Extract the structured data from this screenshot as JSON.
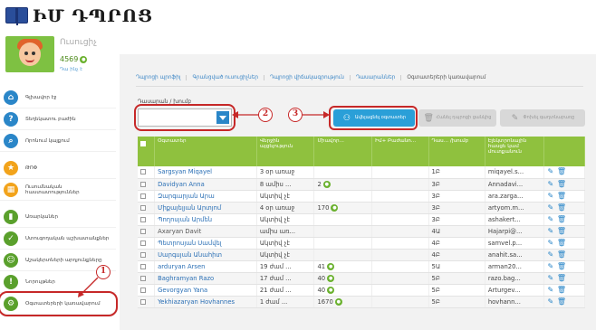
{
  "brand": {
    "title": "ԻՄ ԴՊՐՈՑ"
  },
  "profile": {
    "name": "Ուսուցիչ",
    "points": "4569",
    "what_is": "Դա ինչ է"
  },
  "sidebar": {
    "items": [
      {
        "label": "Գլխավոր էջ",
        "icon": "house-icon",
        "glyph": "⌂",
        "color": "#2a86c8"
      },
      {
        "label": "Տեղեկատու բաժին",
        "icon": "question-icon",
        "glyph": "?",
        "color": "#2a86c8"
      },
      {
        "label": "Որոնում կայքում",
        "icon": "search-icon",
        "glyph": "⌕",
        "color": "#2a86c8"
      },
      {
        "label": "ԹՈՓ",
        "icon": "star-icon",
        "glyph": "★",
        "color": "#f2a31b"
      },
      {
        "label": "Ուսումնական հաստատություններ",
        "icon": "building-icon",
        "glyph": "▦",
        "color": "#f2a31b"
      },
      {
        "label": "Առարկաներ",
        "icon": "books-icon",
        "glyph": "▮",
        "color": "#5aa02c"
      },
      {
        "label": "Ստուգողական աշխատանքներ",
        "icon": "check-icon",
        "glyph": "✓",
        "color": "#5aa02c"
      },
      {
        "label": "Աշակերտների արդյունքները",
        "icon": "users-icon",
        "glyph": "☺",
        "color": "#5aa02c"
      },
      {
        "label": "Նորույթներ",
        "icon": "alert-icon",
        "glyph": "!",
        "color": "#5aa02c"
      },
      {
        "label": "Օգտատերերի կառավարում",
        "icon": "gear-icon",
        "glyph": "⚙",
        "color": "#5aa02c"
      }
    ]
  },
  "tabs": [
    {
      "label": "Դպրոցի պրոֆիլ"
    },
    {
      "label": "Գրանցված ուսուցիչներ"
    },
    {
      "label": "Դպրոցի վիճակագրություն"
    },
    {
      "label": "Դասարաններ"
    },
    {
      "label": "Օգտատերերի կառավարում"
    }
  ],
  "class_select": {
    "label": "Դասարան / խումբ",
    "value": ""
  },
  "buttons": {
    "add_students": "Ավելացնել օգտատեր",
    "remove_from_school": "Հանել դպրոցի ցանկից",
    "change_password": "Փոխել գաղտնաբառը"
  },
  "annotations": [
    "1",
    "2",
    "3"
  ],
  "table": {
    "headers": [
      "Օգտատեր",
      "Վերջին այցելություն",
      "Միավոր...",
      "Իմ+ Բաժանո...",
      "Դաս... /խումբ",
      "Էլեկտրոնային հասցե կամ մուտքանուն"
    ],
    "rows": [
      {
        "name": "Sargsyan Miqayel",
        "last": "3 օր առաջ",
        "points": "",
        "sub": "",
        "cls": "1Բ",
        "email": "miqayel.s...",
        "style": "link"
      },
      {
        "name": "Davidyan Anna",
        "last": "8 ամիս ...",
        "points": "2",
        "sub": "",
        "cls": "3Բ",
        "email": "Annadavi...",
        "style": "link"
      },
      {
        "name": "Զարգարյան Արա",
        "last": "Ակտիվ չէ",
        "points": "",
        "sub": "",
        "cls": "3Բ",
        "email": "ara.zarga...",
        "style": "link"
      },
      {
        "name": "Միքայելյան Արտյոմ",
        "last": "4 օր առաջ",
        "points": "170",
        "sub": "",
        "cls": "3Բ",
        "email": "artyom.m...",
        "style": "link"
      },
      {
        "name": "Պողոսյան Արմեն",
        "last": "Ակտիվ չէ",
        "points": "",
        "sub": "",
        "cls": "3Բ",
        "email": "ashakert...",
        "style": "link"
      },
      {
        "name": "Axaryan Davit",
        "last": "ամիս առ...",
        "points": "",
        "sub": "",
        "cls": "4Ա",
        "email": "Hajarpi@...",
        "style": "plain"
      },
      {
        "name": "Պետրոսյան Սամվել",
        "last": "Ակտիվ չէ",
        "points": "",
        "sub": "",
        "cls": "4Բ",
        "email": "samvel.p...",
        "style": "link"
      },
      {
        "name": "Սարգսյան Անահիտ",
        "last": "Ակտիվ չէ",
        "points": "",
        "sub": "",
        "cls": "4Բ",
        "email": "anahit.sa...",
        "style": "link"
      },
      {
        "name": "arduryan Arsen",
        "last": "19 ժամ ...",
        "points": "41",
        "sub": "",
        "cls": "5Ա",
        "email": "arman20...",
        "style": "link"
      },
      {
        "name": "Baghramyan Razo",
        "last": "17 ժամ ...",
        "points": "40",
        "sub": "",
        "cls": "5Բ",
        "email": "razo.bag...",
        "style": "link"
      },
      {
        "name": "Gevorgyan Yana",
        "last": "21 ժամ ...",
        "points": "40",
        "sub": "",
        "cls": "5Բ",
        "email": "Arturgev...",
        "style": "link"
      },
      {
        "name": "Yekhiazaryan Hovhannes",
        "last": "1 ժամ ...",
        "points": "1670",
        "sub": "",
        "cls": "5Բ",
        "email": "hovhann...",
        "style": "link"
      }
    ]
  },
  "colors": {
    "accent": "#2a86c8",
    "header_green": "#8fc13e",
    "annotation_red": "#c62828",
    "coin_green": "#6ab12e"
  }
}
